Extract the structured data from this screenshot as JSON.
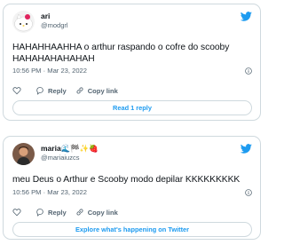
{
  "tweets": [
    {
      "name": "ari",
      "handle": "@modgrl",
      "text": "HAHAHHAAHHA o arthur raspando o cofre do scooby\nHAHAHAHAHAHAH",
      "timestamp": "10:56 PM · Mar 23, 2022",
      "actions": {
        "reply": "Reply",
        "copy": "Copy link"
      },
      "footer_button": "Read 1 reply",
      "icons": [
        "hello-kitty-avatar",
        "twitter-bird-icon",
        "info-icon",
        "heart-icon",
        "reply-icon",
        "link-icon"
      ]
    },
    {
      "name": "maria🌊🏁✨🍓",
      "handle": "@mariaiuzcs",
      "text": "meu Deus o Arthur e Scooby modo depilar KKKKKKKKK",
      "timestamp": "10:56 PM · Mar 23, 2022",
      "actions": {
        "reply": "Reply",
        "copy": "Copy link"
      },
      "footer_button": "Explore what's happening on Twitter",
      "icons": [
        "person-photo-avatar",
        "twitter-bird-icon",
        "info-icon",
        "heart-icon",
        "reply-icon",
        "link-icon"
      ]
    }
  ],
  "colors": {
    "accent": "#1d9bf0",
    "text": "#0f1419",
    "secondary": "#536471",
    "border": "#cfd9de"
  }
}
